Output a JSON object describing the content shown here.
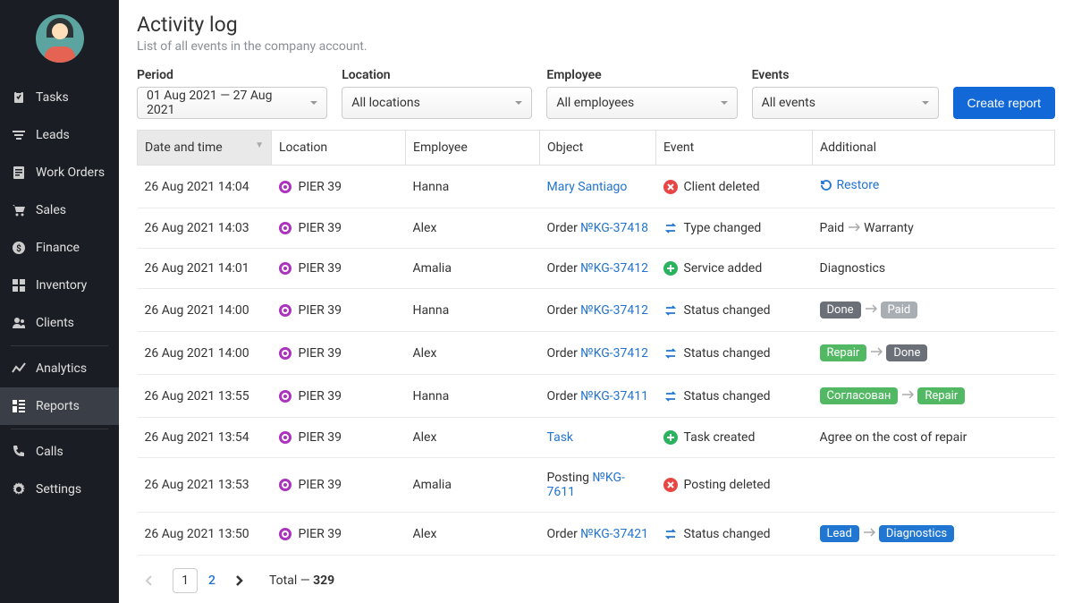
{
  "sidebar": {
    "items": [
      {
        "label": "Tasks",
        "icon": "clipboard"
      },
      {
        "label": "Leads",
        "icon": "filter"
      },
      {
        "label": "Work Orders",
        "icon": "doc"
      },
      {
        "label": "Sales",
        "icon": "cart"
      },
      {
        "label": "Finance",
        "icon": "dollar"
      },
      {
        "label": "Inventory",
        "icon": "boxes"
      },
      {
        "label": "Clients",
        "icon": "users"
      },
      {
        "label": "Analytics",
        "icon": "chart"
      },
      {
        "label": "Reports",
        "icon": "grid",
        "active": true
      },
      {
        "label": "Calls",
        "icon": "phone"
      },
      {
        "label": "Settings",
        "icon": "gear"
      }
    ]
  },
  "page": {
    "title": "Activity log",
    "subtitle": "List of all events in the company account."
  },
  "filters": {
    "period": {
      "label": "Period",
      "value": "01 Aug 2021 — 27 Aug 2021"
    },
    "location": {
      "label": "Location",
      "value": "All locations"
    },
    "employee": {
      "label": "Employee",
      "value": "All employees"
    },
    "events": {
      "label": "Events",
      "value": "All events"
    },
    "create_report": "Create report"
  },
  "table": {
    "headers": {
      "dt": "Date and time",
      "loc": "Location",
      "emp": "Employee",
      "obj": "Object",
      "evt": "Event",
      "add": "Additional"
    },
    "restore_label": "Restore",
    "rows": [
      {
        "dt": "26 Aug 2021 14:04",
        "loc": "PIER 39",
        "emp": "Hanna",
        "obj_type": "link",
        "obj_text": "Mary Santiago",
        "evt_icon": "delete",
        "evt_text": "Client deleted",
        "add_type": "restore"
      },
      {
        "dt": "26 Aug 2021 14:03",
        "loc": "PIER 39",
        "emp": "Alex",
        "obj_type": "order",
        "obj_prefix": "Order ",
        "obj_link": "№KG-37418",
        "evt_icon": "change",
        "evt_text": "Type changed",
        "add_type": "text-arrow",
        "add_from": "Paid",
        "add_to": "Warranty"
      },
      {
        "dt": "26 Aug 2021 14:01",
        "loc": "PIER 39",
        "emp": "Amalia",
        "obj_type": "order",
        "obj_prefix": "Order ",
        "obj_link": "№KG-37412",
        "evt_icon": "add",
        "evt_text": "Service added",
        "add_type": "text",
        "add_text": "Diagnostics"
      },
      {
        "dt": "26 Aug 2021 14:00",
        "loc": "PIER 39",
        "emp": "Hanna",
        "obj_type": "order",
        "obj_prefix": "Order ",
        "obj_link": "№KG-37412",
        "evt_icon": "change",
        "evt_text": "Status changed",
        "add_type": "badge-arrow",
        "from_badge": "Done",
        "from_color": "gray-dark",
        "to_badge": "Paid",
        "to_color": "gray"
      },
      {
        "dt": "26 Aug 2021 14:00",
        "loc": "PIER 39",
        "emp": "Alex",
        "obj_type": "order",
        "obj_prefix": "Order ",
        "obj_link": "№KG-37412",
        "evt_icon": "change",
        "evt_text": "Status changed",
        "add_type": "badge-arrow",
        "from_badge": "Repair",
        "from_color": "green",
        "to_badge": "Done",
        "to_color": "gray-dark"
      },
      {
        "dt": "26 Aug 2021 13:55",
        "loc": "PIER 39",
        "emp": "Hanna",
        "obj_type": "order",
        "obj_prefix": "Order ",
        "obj_link": "№KG-37411",
        "evt_icon": "change",
        "evt_text": "Status changed",
        "add_type": "badge-arrow",
        "from_badge": "Согласован",
        "from_color": "green",
        "to_badge": "Repair",
        "to_color": "green"
      },
      {
        "dt": "26 Aug 2021 13:54",
        "loc": "PIER 39",
        "emp": "Alex",
        "obj_type": "link",
        "obj_text": "Task",
        "evt_icon": "add",
        "evt_text": "Task created",
        "add_type": "text",
        "add_text": "Agree on the cost of repair"
      },
      {
        "dt": "26 Aug 2021 13:53",
        "loc": "PIER 39",
        "emp": "Amalia",
        "obj_type": "order",
        "obj_prefix": "Posting ",
        "obj_link": "№KG-7611",
        "evt_icon": "delete",
        "evt_text": "Posting deleted",
        "add_type": "none"
      },
      {
        "dt": "26 Aug 2021 13:50",
        "loc": "PIER 39",
        "emp": "Alex",
        "obj_type": "order",
        "obj_prefix": "Order ",
        "obj_link": "№KG-37421",
        "evt_icon": "change",
        "evt_text": "Status changed",
        "add_type": "badge-arrow",
        "from_badge": "Lead",
        "from_color": "blue",
        "to_badge": "Diagnostics",
        "to_color": "blue"
      }
    ]
  },
  "pagination": {
    "current": "1",
    "next": "2",
    "total_prefix": "Total — ",
    "total": "329"
  }
}
